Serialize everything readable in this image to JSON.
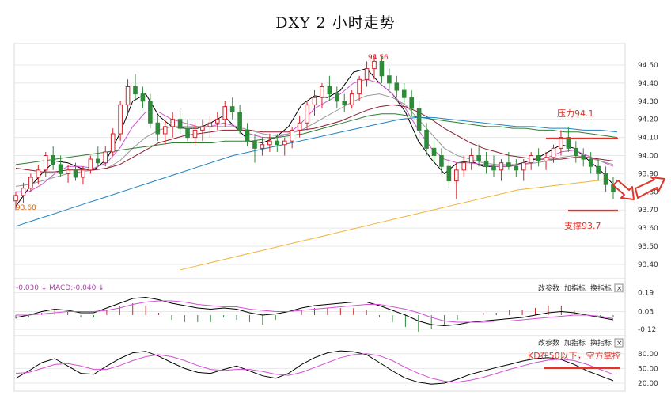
{
  "title": "DXY 2 小时走势",
  "colors": {
    "up": "#d2222a",
    "down": "#2e8b3a",
    "annotation": "#e0352b",
    "ma_short": "#000000",
    "ma_pink": "#d44fd4",
    "ma_gray": "#999999",
    "ma_maroon": "#8b1c2c",
    "ma_green": "#2e7d32",
    "ma_blue": "#1f84c4",
    "ma_orange": "#f2b233",
    "grid": "#e8e8e8"
  },
  "main_panel": {
    "y_ticks": [
      "94.50",
      "94.40",
      "94.30",
      "94.20",
      "94.10",
      "94.00",
      "93.90",
      "93.80",
      "93.70",
      "93.60",
      "93.50",
      "93.40"
    ],
    "high_label": "94.56",
    "low_label": "93.68",
    "resistance_label": "压力94.1",
    "support_label": "支撑93.7"
  },
  "macd_panel": {
    "header": "-0.030 ↓ MACD:-0.040 ↓",
    "buttons": [
      "改参数",
      "加指标",
      "换指标"
    ],
    "close_icon": "×",
    "y_ticks": [
      "0.19",
      "0.03",
      "-0.12"
    ]
  },
  "kd_panel": {
    "buttons": [
      "改参数",
      "加指标",
      "换指标"
    ],
    "close_icon": "×",
    "annotation": "KD在50以下，空方掌控",
    "y_ticks": [
      "80.00",
      "50.00",
      "20.00"
    ]
  },
  "chart_data": {
    "type": "candlestick",
    "title": "DXY 2 小时走势",
    "ylim": [
      93.35,
      94.56
    ],
    "resistance": 94.1,
    "support": 93.7,
    "candles": [
      [
        93.75,
        93.8,
        93.7,
        93.78
      ],
      [
        93.78,
        93.85,
        93.74,
        93.82
      ],
      [
        93.82,
        93.9,
        93.8,
        93.88
      ],
      [
        93.88,
        93.95,
        93.84,
        93.92
      ],
      [
        93.92,
        94.02,
        93.88,
        94.0
      ],
      [
        94.0,
        94.05,
        93.92,
        93.95
      ],
      [
        93.95,
        94.0,
        93.88,
        93.9
      ],
      [
        93.9,
        93.95,
        93.85,
        93.92
      ],
      [
        93.92,
        93.96,
        93.86,
        93.88
      ],
      [
        93.88,
        93.94,
        93.84,
        93.92
      ],
      [
        93.92,
        94.0,
        93.9,
        93.98
      ],
      [
        93.98,
        94.05,
        93.94,
        93.96
      ],
      [
        93.96,
        94.05,
        93.94,
        94.02
      ],
      [
        94.02,
        94.15,
        94.0,
        94.12
      ],
      [
        94.12,
        94.3,
        94.08,
        94.28
      ],
      [
        94.28,
        94.42,
        94.22,
        94.38
      ],
      [
        94.38,
        94.45,
        94.3,
        94.34
      ],
      [
        94.34,
        94.38,
        94.26,
        94.3
      ],
      [
        94.3,
        94.34,
        94.15,
        94.18
      ],
      [
        94.18,
        94.22,
        94.08,
        94.12
      ],
      [
        94.12,
        94.2,
        94.06,
        94.16
      ],
      [
        94.16,
        94.24,
        94.1,
        94.2
      ],
      [
        94.2,
        94.26,
        94.12,
        94.15
      ],
      [
        94.15,
        94.2,
        94.08,
        94.1
      ],
      [
        94.1,
        94.18,
        94.06,
        94.14
      ],
      [
        94.14,
        94.2,
        94.08,
        94.16
      ],
      [
        94.16,
        94.22,
        94.1,
        94.18
      ],
      [
        94.18,
        94.24,
        94.14,
        94.2
      ],
      [
        94.2,
        94.3,
        94.16,
        94.27
      ],
      [
        94.27,
        94.32,
        94.2,
        94.24
      ],
      [
        94.24,
        94.28,
        94.12,
        94.14
      ],
      [
        94.14,
        94.18,
        94.05,
        94.08
      ],
      [
        94.08,
        94.12,
        93.96,
        94.04
      ],
      [
        94.04,
        94.1,
        94.0,
        94.06
      ],
      [
        94.06,
        94.12,
        94.02,
        94.08
      ],
      [
        94.08,
        94.12,
        94.02,
        94.06
      ],
      [
        94.06,
        94.1,
        94.0,
        94.08
      ],
      [
        94.08,
        94.16,
        94.04,
        94.14
      ],
      [
        94.14,
        94.22,
        94.1,
        94.18
      ],
      [
        94.18,
        94.3,
        94.14,
        94.28
      ],
      [
        94.28,
        94.36,
        94.22,
        94.32
      ],
      [
        94.32,
        94.4,
        94.26,
        94.38
      ],
      [
        94.38,
        94.44,
        94.3,
        94.34
      ],
      [
        94.34,
        94.38,
        94.26,
        94.3
      ],
      [
        94.3,
        94.34,
        94.24,
        94.28
      ],
      [
        94.28,
        94.36,
        94.26,
        94.34
      ],
      [
        94.34,
        94.44,
        94.3,
        94.42
      ],
      [
        94.42,
        94.52,
        94.38,
        94.48
      ],
      [
        94.48,
        94.56,
        94.42,
        94.52
      ],
      [
        94.52,
        94.55,
        94.4,
        94.44
      ],
      [
        94.44,
        94.48,
        94.36,
        94.4
      ],
      [
        94.4,
        94.44,
        94.32,
        94.36
      ],
      [
        94.36,
        94.4,
        94.28,
        94.32
      ],
      [
        94.32,
        94.36,
        94.22,
        94.26
      ],
      [
        94.26,
        94.3,
        94.1,
        94.14
      ],
      [
        94.14,
        94.18,
        94.0,
        94.04
      ],
      [
        94.04,
        94.08,
        93.96,
        94.0
      ],
      [
        94.0,
        94.04,
        93.9,
        93.94
      ],
      [
        93.94,
        93.98,
        93.82,
        93.86
      ],
      [
        93.86,
        93.96,
        93.76,
        93.92
      ],
      [
        93.92,
        94.0,
        93.88,
        93.96
      ],
      [
        93.96,
        94.04,
        93.92,
        94.0
      ],
      [
        94.0,
        94.06,
        93.94,
        93.97
      ],
      [
        93.97,
        94.02,
        93.9,
        93.94
      ],
      [
        93.94,
        94.0,
        93.88,
        93.92
      ],
      [
        93.92,
        93.98,
        93.86,
        93.96
      ],
      [
        93.96,
        94.02,
        93.92,
        93.94
      ],
      [
        93.94,
        93.98,
        93.88,
        93.92
      ],
      [
        93.92,
        93.98,
        93.86,
        93.96
      ],
      [
        93.96,
        94.02,
        93.92,
        94.0
      ],
      [
        94.0,
        94.04,
        93.94,
        93.97
      ],
      [
        93.97,
        94.02,
        93.92,
        93.99
      ],
      [
        93.99,
        94.06,
        93.96,
        94.04
      ],
      [
        94.04,
        94.14,
        94.0,
        94.1
      ],
      [
        94.1,
        94.16,
        94.02,
        94.04
      ],
      [
        94.04,
        94.08,
        93.96,
        94.0
      ],
      [
        94.0,
        94.04,
        93.94,
        93.98
      ],
      [
        93.98,
        94.02,
        93.9,
        93.94
      ],
      [
        93.94,
        93.98,
        93.86,
        93.9
      ],
      [
        93.9,
        93.94,
        93.8,
        93.84
      ],
      [
        93.84,
        93.88,
        93.76,
        93.8
      ]
    ],
    "ma_lines": [
      {
        "key": "ma_short",
        "values": [
          93.72,
          93.82,
          93.9,
          93.97,
          93.96,
          93.93,
          93.92,
          93.98,
          94.12,
          94.3,
          94.34,
          94.22,
          94.16,
          94.15,
          94.15,
          94.18,
          94.22,
          94.15,
          94.08,
          94.07,
          94.1,
          94.16,
          94.28,
          94.33,
          94.32,
          94.36,
          94.46,
          94.48,
          94.4,
          94.34,
          94.24,
          94.08,
          93.98,
          93.9,
          93.96,
          93.97,
          93.94,
          93.94,
          93.94,
          93.96,
          93.98,
          94.02,
          94.06,
          94.04,
          93.98,
          93.92,
          93.84
        ]
      },
      {
        "key": "ma_pink",
        "values": [
          93.8,
          93.8,
          93.84,
          93.9,
          93.94,
          93.94,
          93.93,
          93.96,
          94.04,
          94.16,
          94.24,
          94.24,
          94.2,
          94.18,
          94.16,
          94.16,
          94.18,
          94.16,
          94.12,
          94.1,
          94.1,
          94.12,
          94.18,
          94.26,
          94.3,
          94.34,
          94.4,
          94.42,
          94.4,
          94.34,
          94.26,
          94.14,
          94.04,
          93.98,
          93.96,
          93.96,
          93.95,
          93.94,
          93.94,
          93.95,
          93.97,
          93.99,
          94.02,
          94.03,
          94.0,
          93.97,
          93.94
        ]
      },
      {
        "key": "ma_gray",
        "values": [
          93.83,
          93.84,
          93.86,
          93.88,
          93.9,
          93.91,
          93.92,
          93.93,
          93.97,
          94.04,
          94.1,
          94.14,
          94.16,
          94.16,
          94.16,
          94.16,
          94.16,
          94.16,
          94.14,
          94.12,
          94.11,
          94.12,
          94.14,
          94.18,
          94.22,
          94.26,
          94.3,
          94.33,
          94.34,
          94.32,
          94.28,
          94.2,
          94.12,
          94.04,
          94.0,
          93.98,
          93.96,
          93.95,
          93.95,
          93.95,
          93.96,
          93.97,
          93.99,
          94.0,
          93.99,
          93.97,
          93.95
        ]
      },
      {
        "key": "ma_maroon",
        "values": [
          93.93,
          93.92,
          93.91,
          93.91,
          93.92,
          93.92,
          93.92,
          93.93,
          93.95,
          93.99,
          94.03,
          94.07,
          94.09,
          94.11,
          94.12,
          94.13,
          94.14,
          94.14,
          94.14,
          94.13,
          94.13,
          94.13,
          94.14,
          94.15,
          94.17,
          94.19,
          94.22,
          94.25,
          94.27,
          94.28,
          94.27,
          94.24,
          94.2,
          94.15,
          94.11,
          94.07,
          94.04,
          94.02,
          94.0,
          93.99,
          93.98,
          93.98,
          93.98,
          93.99,
          93.99,
          93.98,
          93.97
        ]
      },
      {
        "key": "ma_green",
        "values": [
          93.95,
          93.96,
          93.97,
          93.98,
          93.99,
          94.0,
          94.01,
          94.02,
          94.03,
          94.04,
          94.05,
          94.06,
          94.07,
          94.07,
          94.07,
          94.07,
          94.08,
          94.08,
          94.08,
          94.09,
          94.1,
          94.11,
          94.12,
          94.14,
          94.16,
          94.18,
          94.2,
          94.22,
          94.23,
          94.23,
          94.22,
          94.21,
          94.2,
          94.19,
          94.18,
          94.17,
          94.16,
          94.16,
          94.15,
          94.15,
          94.14,
          94.14,
          94.13,
          94.13,
          94.12,
          94.11,
          94.1
        ]
      },
      {
        "key": "ma_blue",
        "values": [
          93.61,
          93.64,
          93.67,
          93.7,
          93.73,
          93.76,
          93.79,
          93.82,
          93.85,
          93.88,
          93.91,
          93.94,
          93.97,
          94.0,
          94.02,
          94.04,
          94.06,
          94.08,
          94.1,
          94.12,
          94.14,
          94.16,
          94.18,
          94.2,
          94.21,
          94.21,
          94.2,
          94.19,
          94.18,
          94.17,
          94.16,
          94.16,
          94.15,
          94.15,
          94.14,
          94.14,
          94.13
        ]
      },
      {
        "key": "ma_orange",
        "values": [
          93.37,
          93.39,
          93.41,
          93.43,
          93.45,
          93.47,
          93.49,
          93.51,
          93.53,
          93.55,
          93.57,
          93.59,
          93.61,
          93.63,
          93.65,
          93.67,
          93.69,
          93.71,
          93.73,
          93.75,
          93.77,
          93.79,
          93.81,
          93.82,
          93.83,
          93.84,
          93.85,
          93.86,
          93.87
        ]
      }
    ],
    "macd": {
      "dif": [
        -0.02,
        0.0,
        0.03,
        0.05,
        0.04,
        0.02,
        0.02,
        0.06,
        0.1,
        0.14,
        0.15,
        0.13,
        0.1,
        0.08,
        0.06,
        0.05,
        0.06,
        0.05,
        0.02,
        0.0,
        0.01,
        0.03,
        0.06,
        0.08,
        0.09,
        0.1,
        0.11,
        0.11,
        0.08,
        0.04,
        0.0,
        -0.05,
        -0.08,
        -0.09,
        -0.08,
        -0.06,
        -0.05,
        -0.04,
        -0.03,
        -0.02,
        0.0,
        0.02,
        0.03,
        0.02,
        0.0,
        -0.02,
        -0.04
      ],
      "dea": [
        0.0,
        0.0,
        0.01,
        0.02,
        0.03,
        0.03,
        0.03,
        0.04,
        0.06,
        0.09,
        0.11,
        0.12,
        0.12,
        0.11,
        0.09,
        0.08,
        0.07,
        0.07,
        0.05,
        0.04,
        0.03,
        0.03,
        0.04,
        0.05,
        0.06,
        0.07,
        0.08,
        0.09,
        0.09,
        0.07,
        0.05,
        0.02,
        -0.02,
        -0.05,
        -0.06,
        -0.06,
        -0.06,
        -0.05,
        -0.05,
        -0.04,
        -0.03,
        -0.02,
        -0.01,
        0.0,
        0.0,
        -0.01,
        -0.03
      ],
      "histogram": [
        -0.03,
        -0.02,
        0.02,
        0.05,
        0.03,
        -0.02,
        -0.02,
        0.04,
        0.08,
        0.1,
        0.08,
        0.02,
        -0.04,
        -0.06,
        -0.06,
        -0.06,
        -0.02,
        -0.04,
        -0.06,
        -0.08,
        -0.04,
        0.0,
        0.04,
        0.06,
        0.06,
        0.06,
        0.06,
        0.04,
        -0.02,
        -0.06,
        -0.1,
        -0.14,
        -0.12,
        -0.08,
        -0.04,
        0.0,
        0.02,
        0.02,
        0.04,
        0.04,
        0.06,
        0.08,
        0.08,
        0.04,
        0.0,
        -0.02,
        -0.02
      ]
    },
    "kd": {
      "k": [
        30,
        45,
        62,
        70,
        55,
        40,
        38,
        55,
        70,
        82,
        85,
        75,
        62,
        50,
        42,
        40,
        48,
        55,
        45,
        35,
        30,
        40,
        58,
        72,
        82,
        86,
        84,
        78,
        62,
        45,
        30,
        22,
        18,
        20,
        28,
        38,
        45,
        52,
        58,
        65,
        70,
        72,
        68,
        58,
        45,
        35,
        25
      ],
      "d": [
        40,
        42,
        50,
        58,
        60,
        55,
        48,
        48,
        56,
        66,
        74,
        78,
        74,
        66,
        56,
        48,
        46,
        48,
        48,
        44,
        38,
        36,
        42,
        52,
        62,
        72,
        78,
        80,
        76,
        66,
        52,
        40,
        30,
        24,
        22,
        26,
        32,
        40,
        48,
        55,
        62,
        67,
        69,
        66,
        58,
        48,
        38
      ]
    }
  }
}
